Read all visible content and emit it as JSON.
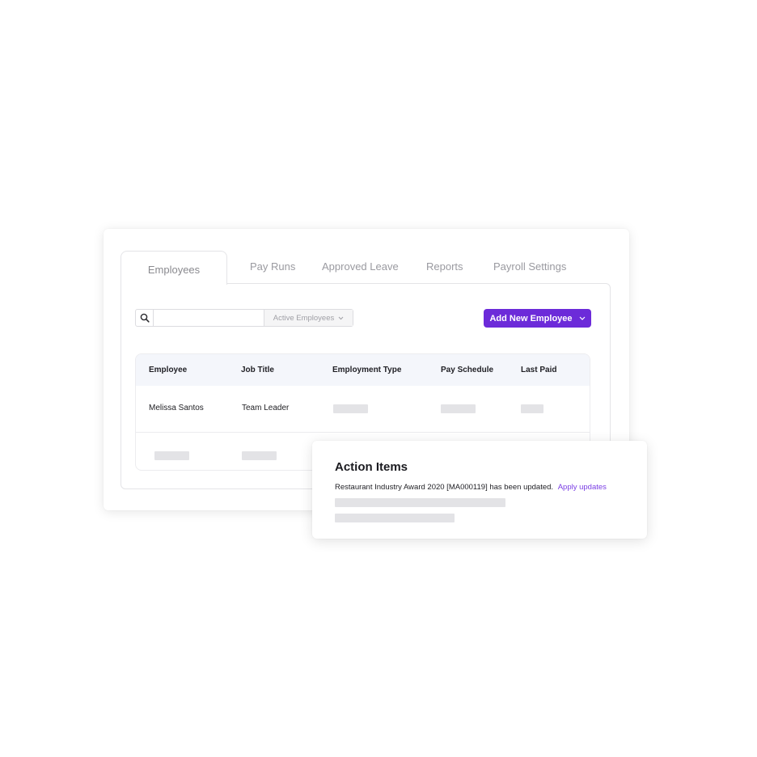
{
  "tabs": [
    {
      "label": "Employees",
      "active": true
    },
    {
      "label": "Pay Runs",
      "active": false
    },
    {
      "label": "Approved Leave",
      "active": false
    },
    {
      "label": "Reports",
      "active": false
    },
    {
      "label": "Payroll Settings",
      "active": false
    }
  ],
  "search": {
    "icon": "search-icon",
    "value": "",
    "placeholder": "",
    "filter_label": "Active Employees",
    "filter_icon": "chevron-down-icon"
  },
  "add_button": {
    "label": "Add New Employee",
    "icon": "chevron-down-icon",
    "color": "#6c2bd9"
  },
  "table": {
    "columns": [
      "Employee",
      "Job Title",
      "Employment Type",
      "Pay Schedule",
      "Last Paid"
    ],
    "rows": [
      {
        "employee": "Melissa Santos",
        "job_title": "Team Leader"
      }
    ]
  },
  "action_items": {
    "title": "Action Items",
    "message": "Restaurant Industry Award 2020 [MA000119] has been updated.",
    "link_label": "Apply updates",
    "link_color": "#7b3fe4"
  }
}
